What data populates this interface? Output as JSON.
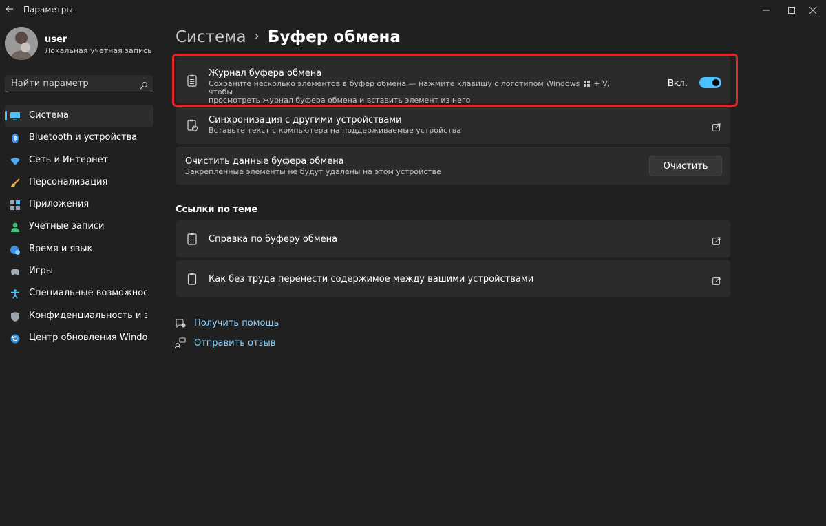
{
  "window": {
    "title": "Параметры"
  },
  "profile": {
    "name": "user",
    "account_type": "Локальная учетная запись"
  },
  "search": {
    "placeholder": "Найти параметр"
  },
  "nav": [
    {
      "label": "Система",
      "icon": "monitor-icon",
      "active": true
    },
    {
      "label": "Bluetooth и устройства",
      "icon": "bluetooth-icon"
    },
    {
      "label": "Сеть и Интернет",
      "icon": "wifi-icon"
    },
    {
      "label": "Персонализация",
      "icon": "brush-icon"
    },
    {
      "label": "Приложения",
      "icon": "apps-icon"
    },
    {
      "label": "Учетные записи",
      "icon": "person-icon"
    },
    {
      "label": "Время и язык",
      "icon": "globe-clock-icon"
    },
    {
      "label": "Игры",
      "icon": "gamepad-icon"
    },
    {
      "label": "Специальные возможности",
      "icon": "accessibility-icon"
    },
    {
      "label": "Конфиденциальность и защита",
      "icon": "shield-icon"
    },
    {
      "label": "Центр обновления Windows",
      "icon": "update-icon"
    }
  ],
  "breadcrumb": {
    "parent": "Система",
    "separator": "›",
    "current": "Буфер обмена"
  },
  "cards": {
    "history": {
      "title": "Журнал буфера обмена",
      "desc_line1": "Сохраните несколько элементов в буфер обмена — нажмите клавишу с логотипом Windows",
      "desc_key": "+ V, чтобы",
      "desc_line2": "просмотреть журнал буфера обмена и вставить элемент из него",
      "toggle_label": "Вкл.",
      "toggle_on": true
    },
    "sync": {
      "title": "Синхронизация с другими устройствами",
      "desc": "Вставьте текст с компьютера на поддерживаемые устройства"
    },
    "clear": {
      "title": "Очистить данные буфера обмена",
      "desc": "Закрепленные элементы не будут удалены на этом устройстве",
      "button": "Очистить"
    }
  },
  "related": {
    "heading": "Ссылки по теме",
    "help": "Справка по буферу обмена",
    "transfer": "Как без труда перенести содержимое между вашими устройствами"
  },
  "footer_links": {
    "get_help": "Получить помощь",
    "feedback": "Отправить отзыв"
  },
  "colors": {
    "accent": "#4cc2ff",
    "highlight": "#e02727",
    "card": "#2b2b2b",
    "background": "#202020"
  }
}
